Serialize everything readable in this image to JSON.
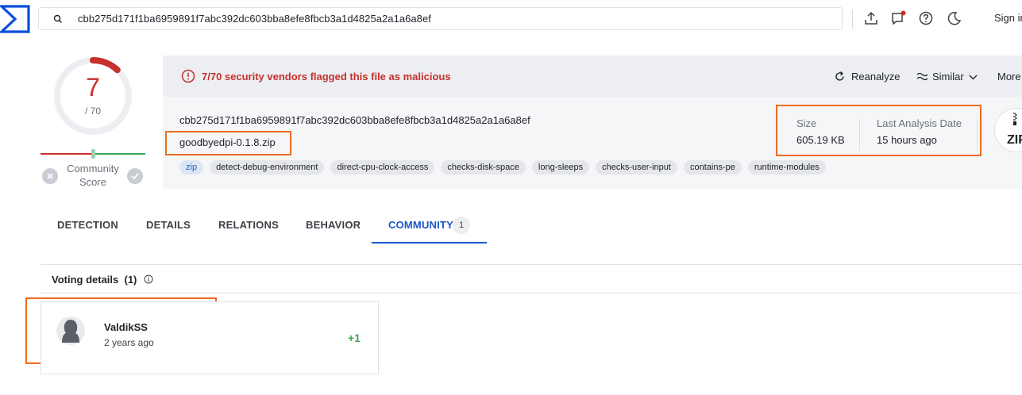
{
  "search": {
    "value": "cbb275d171f1ba6959891f7abc392dc603bba8efe8fbcb3a1d4825a2a1a6a8ef"
  },
  "topbar": {
    "icons": [
      "upload-icon",
      "chat-icon",
      "help-icon",
      "dark-mode-icon"
    ],
    "signin_label": "Sign in"
  },
  "score": {
    "detections": "7",
    "total": "/ 70",
    "community_label_1": "Community",
    "community_label_2": "Score"
  },
  "alert": {
    "text": "7/70 security vendors flagged this file as malicious",
    "actions": {
      "reanalyze": "Reanalyze",
      "similar": "Similar",
      "more": "More"
    }
  },
  "file": {
    "hash": "cbb275d171f1ba6959891f7abc392dc603bba8efe8fbcb3a1d4825a2a1a6a8ef",
    "name": "goodbyedpi-0.1.8.zip",
    "tags": [
      "zip",
      "detect-debug-environment",
      "direct-cpu-clock-access",
      "checks-disk-space",
      "long-sleeps",
      "checks-user-input",
      "contains-pe",
      "runtime-modules"
    ],
    "size_label": "Size",
    "size_value": "605.19 KB",
    "date_label": "Last Analysis Date",
    "date_value": "15 hours ago",
    "type_icon_label": "ZIP"
  },
  "tabs": [
    {
      "label": "DETECTION"
    },
    {
      "label": "DETAILS"
    },
    {
      "label": "RELATIONS"
    },
    {
      "label": "BEHAVIOR"
    },
    {
      "label": "COMMUNITY",
      "count": "1",
      "active": true
    }
  ],
  "voting": {
    "title": "Voting details",
    "count": "(1)",
    "votes": [
      {
        "user": "ValdikSS",
        "time": "2 years ago",
        "vote": "+1"
      }
    ]
  },
  "colors": {
    "malicious": "#c7302c",
    "accent": "#1a57c8",
    "positive": "#3aa55a",
    "highlight": "#ef6a1f"
  }
}
